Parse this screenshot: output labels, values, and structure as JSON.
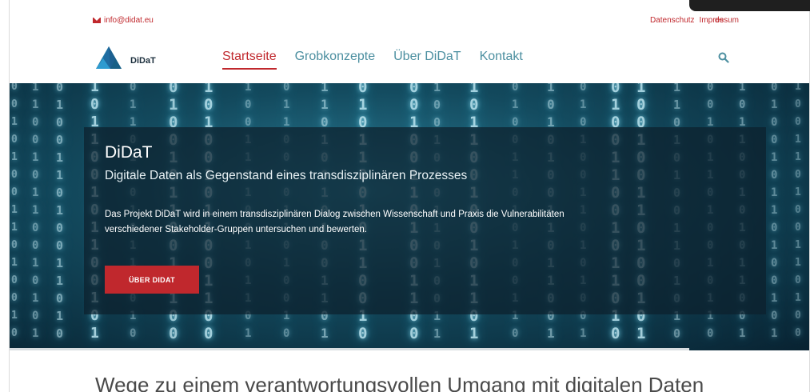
{
  "topbar": {
    "email": "info@didat.eu",
    "links": [
      "Datenschutz",
      "Impressum"
    ],
    "language": "de"
  },
  "nav": {
    "logo_text": "DiDaT",
    "items": [
      {
        "label": "Startseite",
        "active": true
      },
      {
        "label": "Grobkonzepte",
        "active": false
      },
      {
        "label": "Über DiDaT",
        "active": false
      },
      {
        "label": "Kontakt",
        "active": false
      }
    ],
    "search_icon": "search-icon"
  },
  "hero": {
    "title": "DiDaT",
    "subtitle": "Digitale Daten als Gegenstand eines transdisziplinären Prozesses",
    "text": "Das Projekt DiDaT wird in einem transdisziplinären Dialog zwischen Wissenschaft und Praxis die Vulnerabilitäten verschiedener Stakeholder-Gruppen untersuchen und bewerten.",
    "button_label": "ÜBER DIDAT"
  },
  "section": {
    "heading": "Wege zu einem verantwortungsvollen Umgang mit digitalen Daten"
  },
  "colors": {
    "accent": "#c0282d",
    "nav_link": "#4c8fa0",
    "logo_text": "#1b2e3c"
  }
}
